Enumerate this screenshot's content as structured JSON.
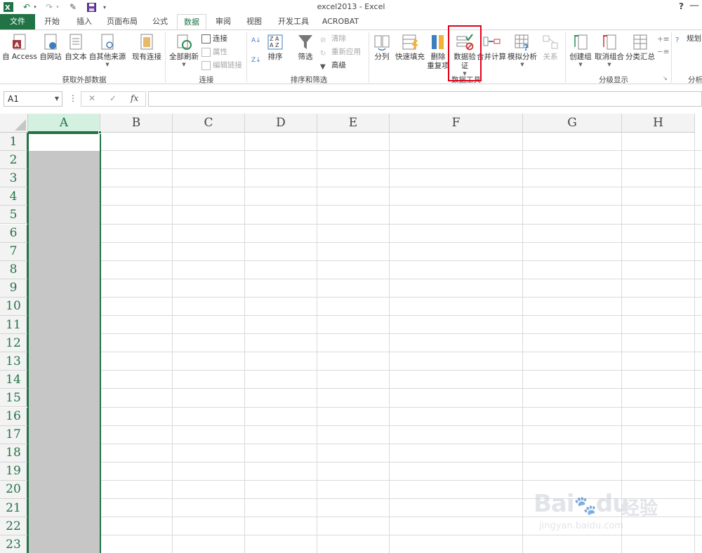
{
  "window": {
    "title": "excel2013 - Excel",
    "help": "?",
    "minimize": "—"
  },
  "tabs": [
    {
      "label": "文件"
    },
    {
      "label": "开始"
    },
    {
      "label": "插入"
    },
    {
      "label": "页面布局"
    },
    {
      "label": "公式"
    },
    {
      "label": "数据"
    },
    {
      "label": "审阅"
    },
    {
      "label": "视图"
    },
    {
      "label": "开发工具"
    },
    {
      "label": "ACROBAT"
    }
  ],
  "ribbon": {
    "get_external": {
      "access": "自 Access",
      "web": "自网站",
      "text": "自文本",
      "other": "自其他来源",
      "existing": "现有连接",
      "group": "获取外部数据"
    },
    "connections": {
      "refresh_all": "全部刷新",
      "connections": "连接",
      "properties": "属性",
      "edit_links": "编辑链接",
      "group": "连接"
    },
    "sort_filter": {
      "sort": "排序",
      "filter": "筛选",
      "clear": "清除",
      "reapply": "重新应用",
      "advanced": "高级",
      "group": "排序和筛选"
    },
    "data_tools": {
      "text_to_columns": "分列",
      "flash_fill": "快速填充",
      "remove_dup_1": "删除",
      "remove_dup_2": "重复项",
      "validation_1": "数据验",
      "validation_2": "证",
      "consolidate": "合并计算",
      "what_if": "模拟分析",
      "relationships": "关系",
      "group": "数据工具"
    },
    "outline": {
      "group_btn": "创建组",
      "ungroup": "取消组合",
      "subtotal": "分类汇总",
      "group": "分级显示"
    },
    "analysis": {
      "solver": "规划",
      "group": "分析"
    }
  },
  "formula_bar": {
    "name_box": "A1",
    "fx": "fx",
    "formula": ""
  },
  "grid": {
    "columns": [
      "A",
      "B",
      "C",
      "D",
      "E",
      "F",
      "G",
      "H"
    ],
    "rows": [
      "1",
      "2",
      "3",
      "4",
      "5",
      "6",
      "7",
      "8",
      "9",
      "10",
      "11",
      "12",
      "13",
      "14",
      "15",
      "16",
      "17",
      "18",
      "19",
      "20",
      "21",
      "22",
      "23"
    ]
  },
  "colors": {
    "accent": "#217346",
    "highlight_box": "#e2001a"
  },
  "watermark": {
    "brand": "Bai",
    "brand2": "du",
    "cn": "经验",
    "url": "jingyan.baidu.com"
  }
}
